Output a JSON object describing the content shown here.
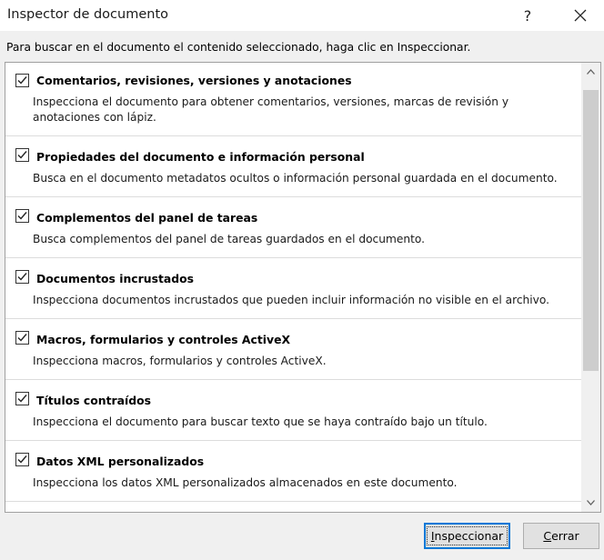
{
  "window": {
    "title": "Inspector de documento",
    "help_glyph": "?"
  },
  "instruction": "Para buscar en el documento el contenido seleccionado, haga clic en Inspeccionar.",
  "items": [
    {
      "title": "Comentarios, revisiones, versiones y anotaciones",
      "checked": true,
      "desc": "Inspecciona el documento para obtener comentarios, versiones, marcas de revisión y anotaciones con lápiz."
    },
    {
      "title": "Propiedades del documento e información personal",
      "checked": true,
      "desc": "Busca en el documento metadatos ocultos o información personal guardada en el documento."
    },
    {
      "title": "Complementos del panel de tareas",
      "checked": true,
      "desc": "Busca complementos del panel de tareas guardados en el documento."
    },
    {
      "title": "Documentos incrustados",
      "checked": true,
      "desc": "Inspecciona documentos incrustados que pueden incluir información no visible en el archivo."
    },
    {
      "title": "Macros, formularios y controles ActiveX",
      "checked": true,
      "desc": "Inspecciona macros, formularios y controles ActiveX."
    },
    {
      "title": "Títulos contraídos",
      "checked": true,
      "desc": "Inspecciona el documento para buscar texto que se haya contraído bajo un título."
    },
    {
      "title": "Datos XML personalizados",
      "checked": true,
      "desc": "Inspecciona los datos XML personalizados almacenados en este documento."
    }
  ],
  "buttons": {
    "inspect_first": "I",
    "inspect_rest": "nspeccionar",
    "close_first": "C",
    "close_rest": "errar"
  },
  "colors": {
    "focus_border": "#0078d7",
    "button_bg": "#e1e1e1"
  }
}
